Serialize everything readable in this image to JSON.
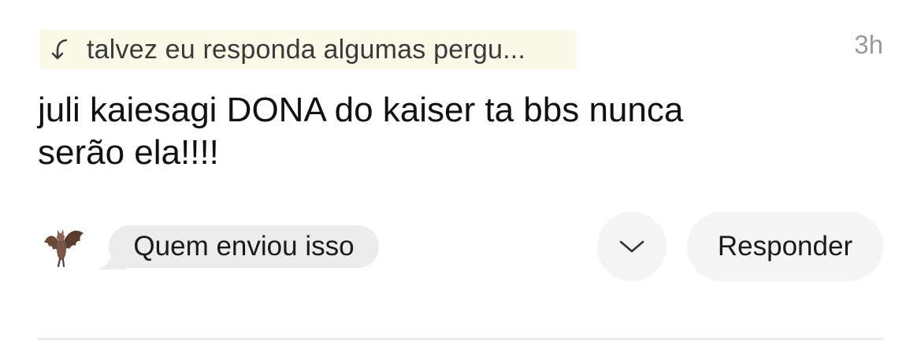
{
  "question_reference": {
    "icon": "reply-arrow-icon",
    "text": "talvez eu responda algumas pergu...",
    "background": "#fbf9e7"
  },
  "timestamp": "3h",
  "message": {
    "line1": "juli kaiesagi DONA do kaiser ta bbs nunca",
    "line2": "serão ela!!!!"
  },
  "sender": {
    "avatar_icon": "bat-emoji-icon",
    "label": "Quem enviou isso"
  },
  "actions": {
    "more_icon": "chevron-down-icon",
    "reply_label": "Responder"
  }
}
